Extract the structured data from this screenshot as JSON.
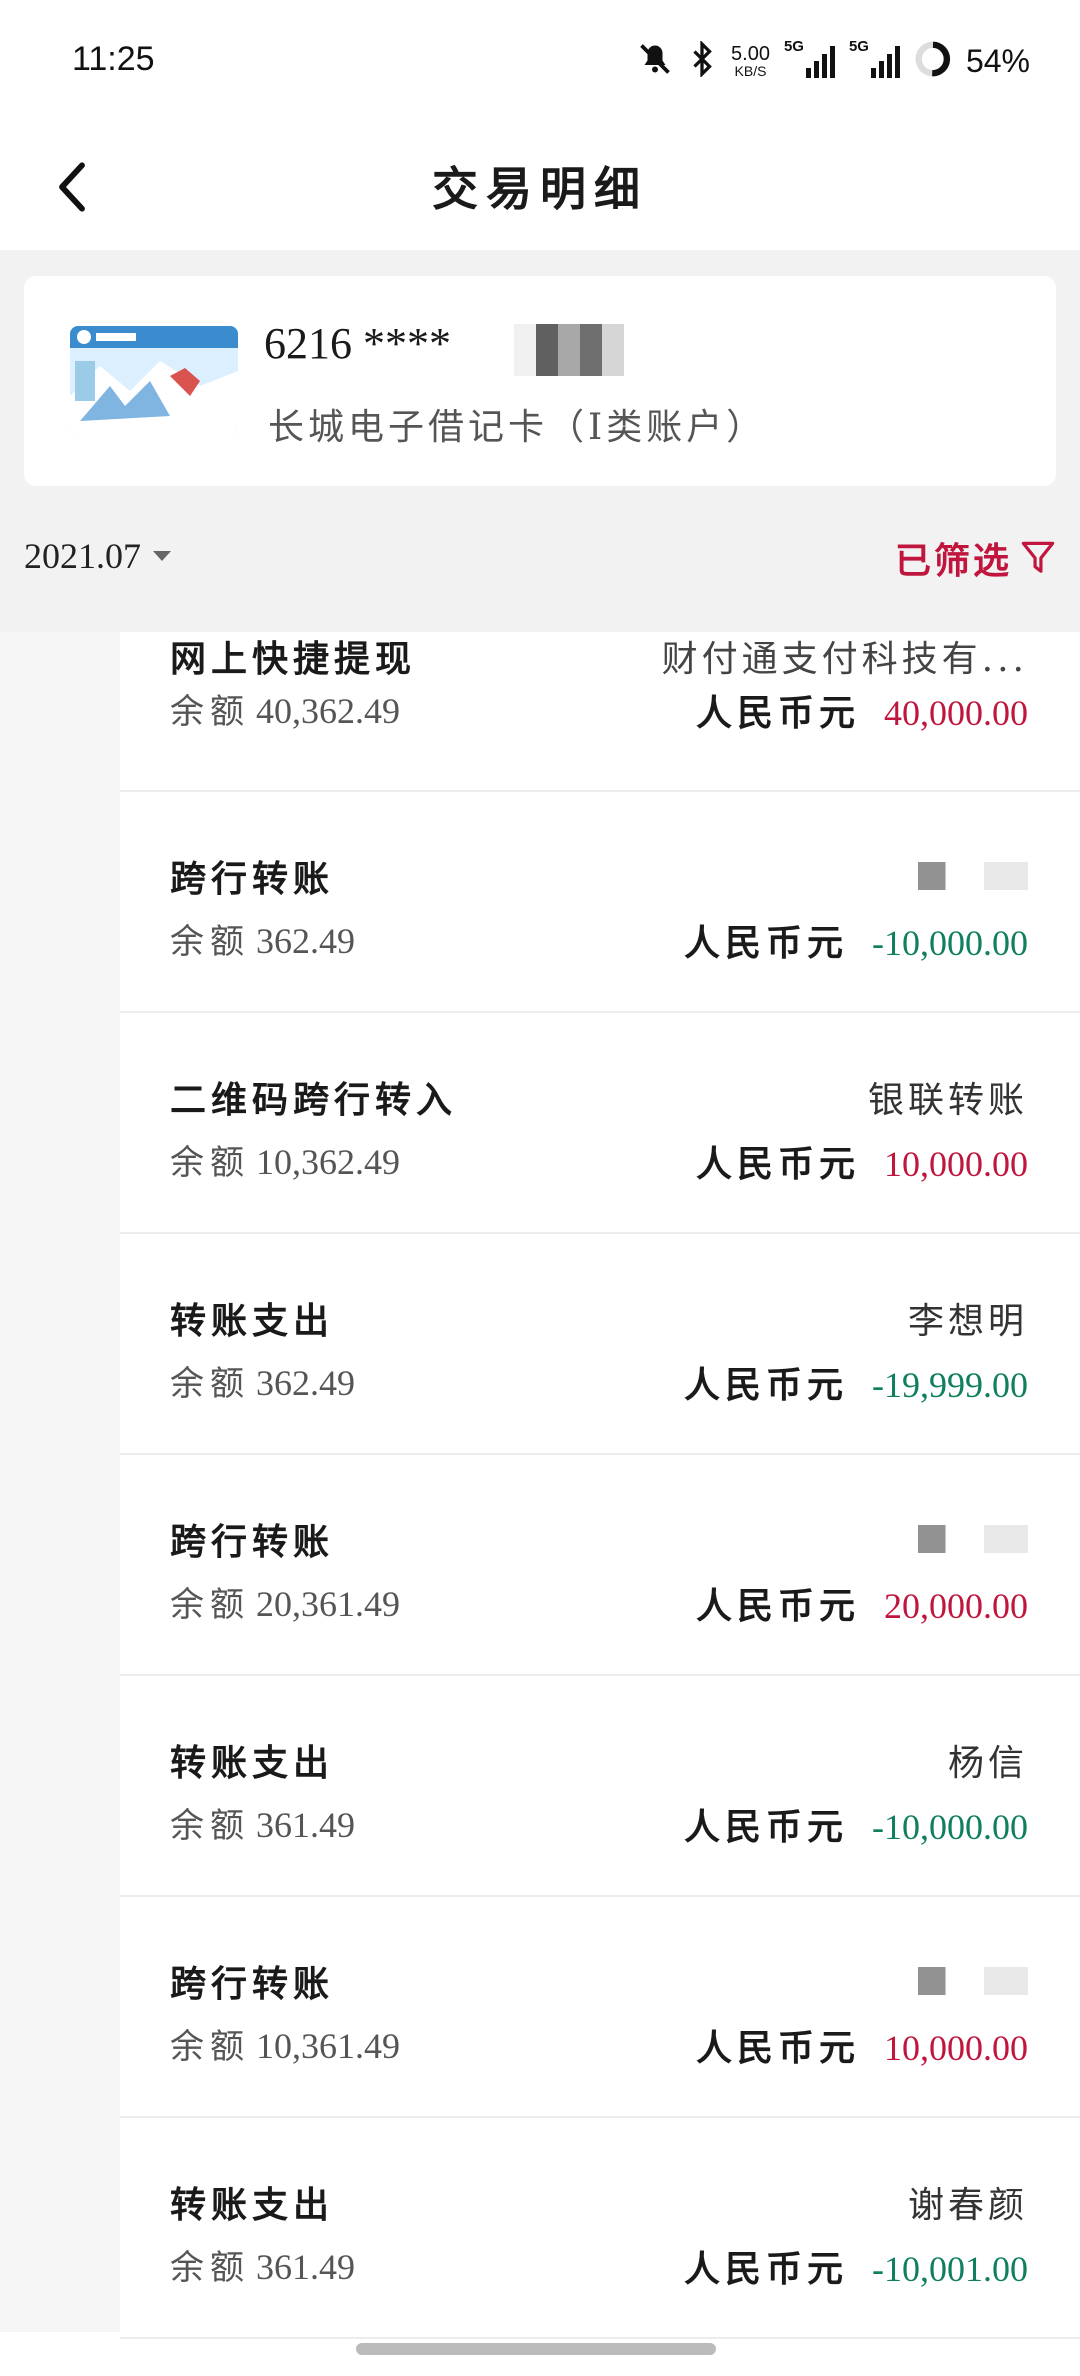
{
  "status_bar": {
    "time": "11:25",
    "net_speed_value": "5.00",
    "net_speed_unit": "KB/S",
    "signal1_label": "5G",
    "signal2_label": "5G",
    "battery_percent": "54%"
  },
  "header": {
    "title": "交易明细"
  },
  "account": {
    "number": "6216 ****",
    "name": "长城电子借记卡（I类账户）"
  },
  "filter": {
    "date": "2021.07",
    "label": "已筛选"
  },
  "balance_label": "余额",
  "transactions": [
    {
      "type": "网上快捷提现",
      "balance": "40,362.49",
      "party": "财付通支付科技有...",
      "currency": "人民币元",
      "amount": "40,000.00",
      "direction": "in"
    },
    {
      "type": "跨行转账",
      "balance": "362.49",
      "party": "",
      "currency": "人民币元",
      "amount": "-10,000.00",
      "direction": "out"
    },
    {
      "type": "二维码跨行转入",
      "balance": "10,362.49",
      "party": "银联转账",
      "currency": "人民币元",
      "amount": "10,000.00",
      "direction": "in"
    },
    {
      "type": "转账支出",
      "balance": "362.49",
      "party": "李想明",
      "currency": "人民币元",
      "amount": "-19,999.00",
      "direction": "out"
    },
    {
      "type": "跨行转账",
      "balance": "20,361.49",
      "party": "",
      "currency": "人民币元",
      "amount": "20,000.00",
      "direction": "in"
    },
    {
      "type": "转账支出",
      "balance": "361.49",
      "party": "杨信",
      "currency": "人民币元",
      "amount": "-10,000.00",
      "direction": "out"
    },
    {
      "type": "跨行转账",
      "balance": "10,361.49",
      "party": "",
      "currency": "人民币元",
      "amount": "10,000.00",
      "direction": "in"
    },
    {
      "type": "转账支出",
      "balance": "361.49",
      "party": "谢春颜",
      "currency": "人民币元",
      "amount": "-10,001.00",
      "direction": "out"
    }
  ],
  "colors": {
    "income": "#c0163e",
    "expense": "#0f7f5f",
    "accent": "#c0163e"
  }
}
